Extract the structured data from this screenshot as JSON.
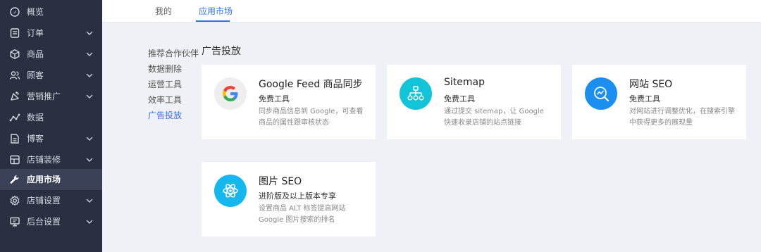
{
  "sidebar": {
    "items": [
      {
        "label": "概览",
        "icon": "dashboard-icon"
      },
      {
        "label": "订单",
        "icon": "order-icon"
      },
      {
        "label": "商品",
        "icon": "product-box-icon"
      },
      {
        "label": "顾客",
        "icon": "customers-icon"
      },
      {
        "label": "营销推广",
        "icon": "marketing-icon"
      },
      {
        "label": "数据",
        "icon": "data-chart-icon"
      },
      {
        "label": "博客",
        "icon": "blog-icon"
      },
      {
        "label": "店铺装修",
        "icon": "store-design-icon"
      },
      {
        "label": "应用市场",
        "icon": "wrench-icon"
      },
      {
        "label": "店铺设置",
        "icon": "settings-icon"
      },
      {
        "label": "后台设置",
        "icon": "monitor-icon"
      }
    ]
  },
  "tabs": [
    {
      "label": "我的"
    },
    {
      "label": "应用市场"
    }
  ],
  "subnav": [
    {
      "label": "推荐合作伙伴"
    },
    {
      "label": "数据删除"
    },
    {
      "label": "运营工具"
    },
    {
      "label": "效率工具"
    },
    {
      "label": "广告投放"
    }
  ],
  "section_title": "广告投放",
  "cards": [
    {
      "title": "Google Feed 商品同步",
      "subtitle": "免费工具",
      "desc": "同步商品信息到 Google，可查看商品的属性跟审核状态",
      "icon": "google-icon",
      "icon_bg": "#eeeeee"
    },
    {
      "title": "Sitemap",
      "subtitle": "免费工具",
      "desc": "通过提交 sitemap，让 Google 快速收录店铺的站点链接",
      "icon": "sitemap-icon",
      "icon_bg": "#12c4d8"
    },
    {
      "title": "网站 SEO",
      "subtitle": "免费工具",
      "desc": "对网站进行调整优化，在搜索引擎中获得更多的展现量",
      "icon": "seo-search-icon",
      "icon_bg": "#1a8ff0"
    },
    {
      "title": "图片 SEO",
      "subtitle": "进阶版及以上版本专享",
      "desc": "设置商品 ALT 标签提高网站 Google 图片搜索的排名",
      "icon": "atom-icon",
      "icon_bg": "#14b8ee"
    }
  ],
  "colors": {
    "accent": "#3173e6",
    "sidebar_bg": "#2a3042"
  }
}
